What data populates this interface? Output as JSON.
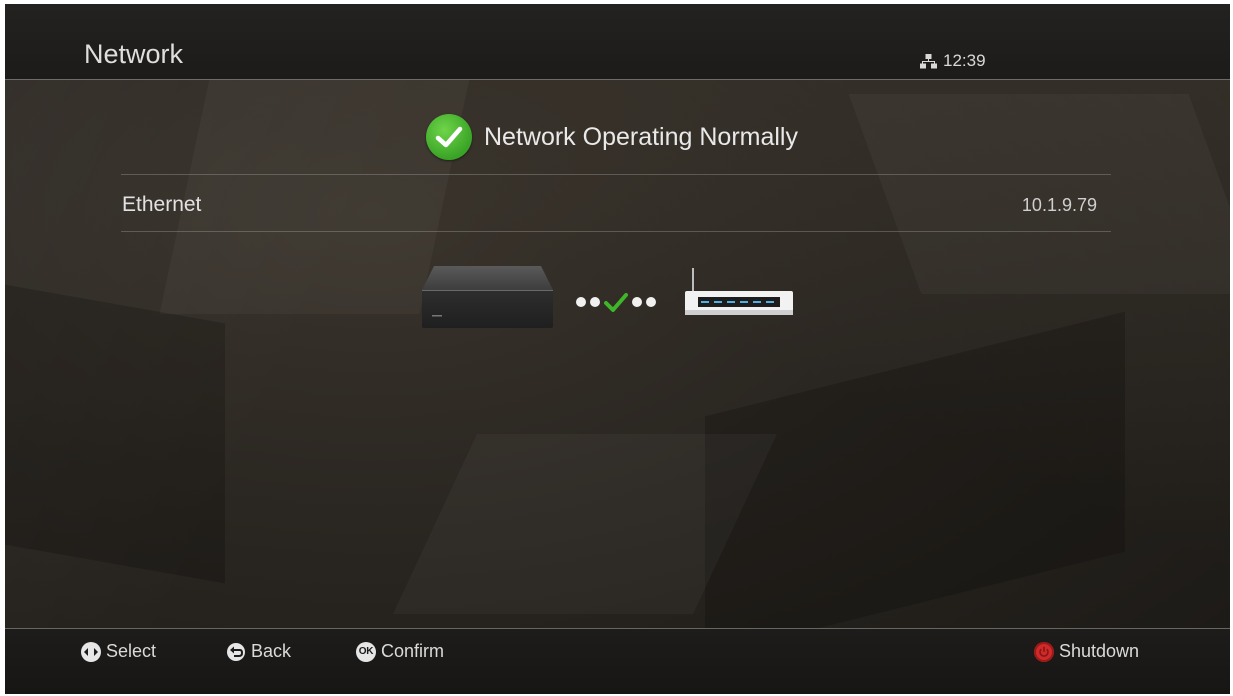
{
  "header": {
    "title": "Network",
    "network_icon": "network-icon",
    "clock": "12:39"
  },
  "status": {
    "icon": "check-circle-icon",
    "text": "Network Operating Normally",
    "color": "#3aa426"
  },
  "connection": {
    "label": "Ethernet",
    "ip_address": "10.1.9.79"
  },
  "diagram": {
    "device_icon": "set-top-box-icon",
    "link_icon": "connection-dots-check-icon",
    "router_icon": "router-icon"
  },
  "footer": {
    "hints": [
      {
        "icon": "dpad-left-right-icon",
        "label": "Select"
      },
      {
        "icon": "back-arrow-icon",
        "label": "Back"
      },
      {
        "icon": "ok-button-icon",
        "label": "Confirm",
        "icon_text": "OK"
      }
    ],
    "shutdown": {
      "icon": "power-button-icon",
      "label": "Shutdown",
      "color": "#cf2a2a"
    }
  }
}
